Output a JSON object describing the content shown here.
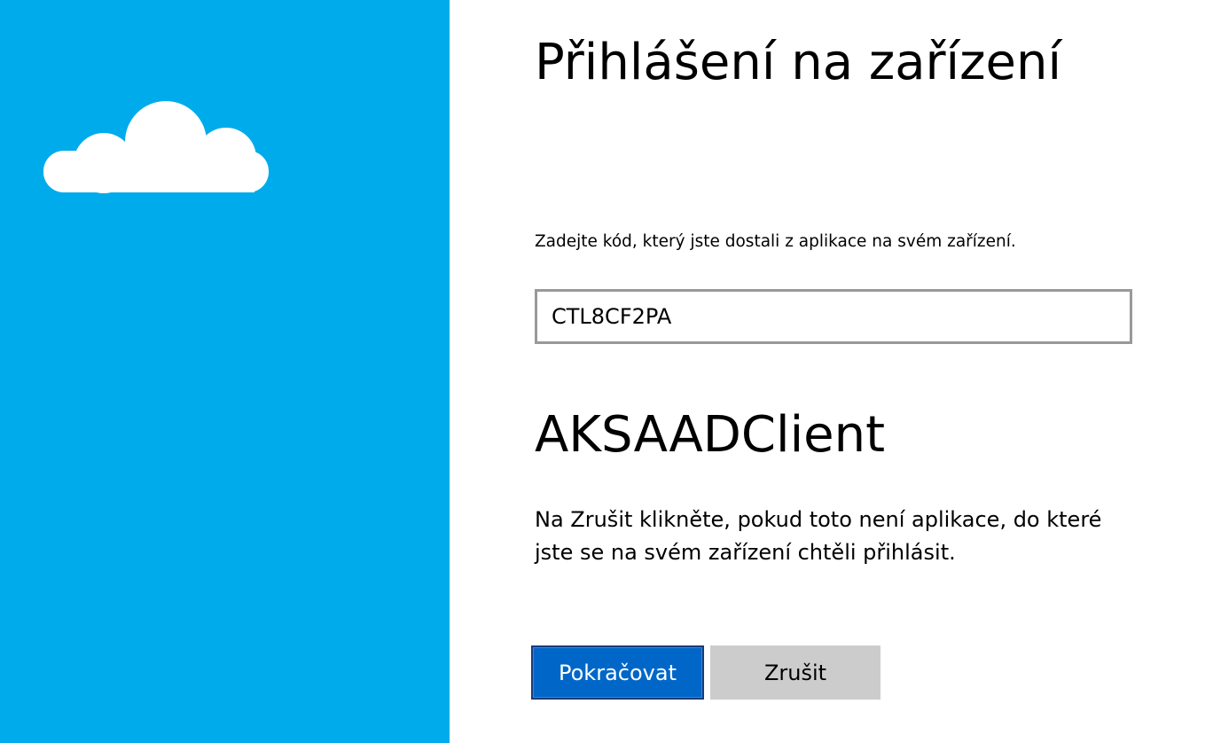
{
  "sidebar": {
    "background_color": "#00abeb",
    "logo_icon": "cloud-icon"
  },
  "main": {
    "title": "Přihlášení na zařízení",
    "instruction": "Zadejte kód, který jste dostali z aplikace na svém zařízení.",
    "code_input": {
      "value": "CTL8CF2PA",
      "placeholder": ""
    },
    "app_name": "AKSAADClient",
    "description": "Na Zrušit klikněte, pokud toto není aplikace, do které jste se na svém zařízení chtěli přihlásit.",
    "buttons": {
      "continue_label": "Pokračovat",
      "cancel_label": "Zrušit"
    }
  },
  "colors": {
    "accent": "#0067c8",
    "cancel_bg": "#cccccc",
    "input_border": "#999999"
  }
}
